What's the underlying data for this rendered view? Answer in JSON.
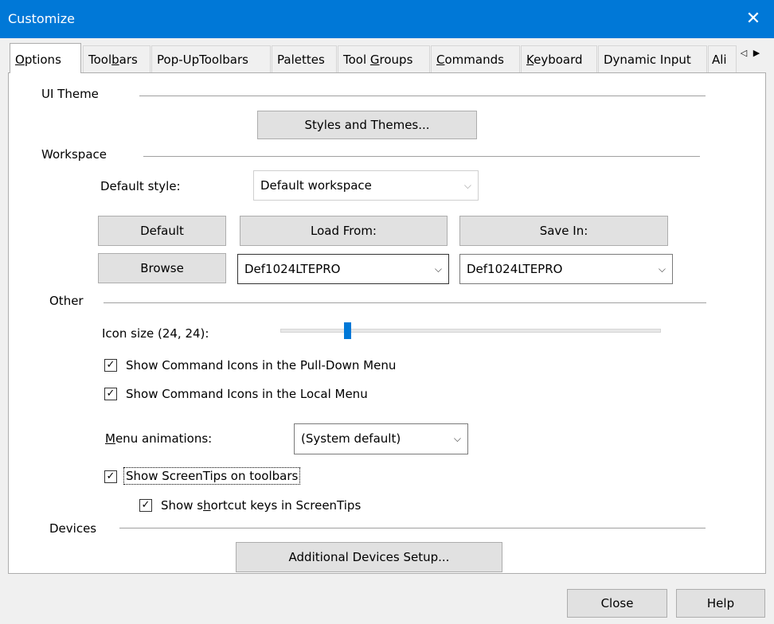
{
  "window": {
    "title": "Customize"
  },
  "tabs": [
    {
      "label": "Options",
      "active": true
    },
    {
      "label": "Toolbars"
    },
    {
      "label": "Pop-UpToolbars"
    },
    {
      "label": "Palettes"
    },
    {
      "label": "Tool Groups"
    },
    {
      "label": "Commands"
    },
    {
      "label": "Keyboard"
    },
    {
      "label": "Dynamic Input"
    },
    {
      "label": "Ali"
    }
  ],
  "ui_theme": {
    "label": "UI Theme",
    "styles_button": "Styles and Themes..."
  },
  "workspace": {
    "label": "Workspace",
    "default_style_label": "Default style:",
    "default_style_value": "Default workspace",
    "default_button": "Default",
    "load_from_button": "Load From:",
    "save_in_button": "Save In:",
    "browse_button": "Browse",
    "load_from_value": "Def1024LTEPRO",
    "save_in_value": "Def1024LTEPRO"
  },
  "other": {
    "label": "Other",
    "icon_size_label": "Icon size (24, 24):",
    "icon_size_fraction": 0.17,
    "show_icons_pulldown": "Show Command Icons in the Pull-Down Menu",
    "show_icons_local": "Show Command Icons in the Local Menu",
    "menu_animations_label": "Menu animations:",
    "menu_animations_value": "(System default)",
    "show_screentips": "Show ScreenTips on toolbars",
    "show_shortcut_keys": "Show shortcut keys in ScreenTips"
  },
  "devices": {
    "label": "Devices",
    "setup_button": "Additional Devices Setup..."
  },
  "footer": {
    "close_button": "Close",
    "help_button": "Help"
  },
  "glyphs": {
    "close": "✕",
    "check": "✓",
    "chevron": "⌵",
    "left": "◁",
    "right": "▶"
  },
  "colors": {
    "titlebar": "#0078d7",
    "accent": "#0078d7"
  }
}
